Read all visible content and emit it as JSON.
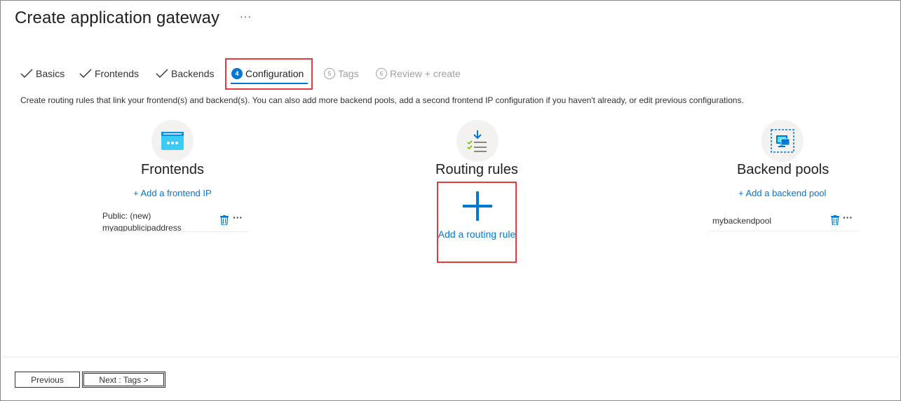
{
  "header": {
    "title": "Create application gateway",
    "more_label": "···"
  },
  "tabs": [
    {
      "label": "Basics",
      "state": "done"
    },
    {
      "label": "Frontends",
      "state": "done"
    },
    {
      "label": "Backends",
      "state": "done"
    },
    {
      "label": "Configuration",
      "number": "4",
      "state": "active"
    },
    {
      "label": "Tags",
      "number": "5",
      "state": "disabled"
    },
    {
      "label": "Review + create",
      "number": "6",
      "state": "disabled"
    }
  ],
  "description": "Create routing rules that link your frontend(s) and backend(s). You can also add more backend pools, add a second frontend IP configuration if you haven't already, or edit previous configurations.",
  "frontends": {
    "title": "Frontends",
    "add_link": "+ Add a frontend IP",
    "items": [
      {
        "line1": "Public: (new)",
        "line2": "myagpublicipaddress"
      }
    ]
  },
  "routing": {
    "title": "Routing rules",
    "add_label": "Add a routing rule"
  },
  "backends": {
    "title": "Backend pools",
    "add_link": "+ Add a backend pool",
    "items": [
      {
        "name": "mybackendpool"
      }
    ]
  },
  "footer": {
    "previous_label": "Previous",
    "next_label": "Next : Tags >"
  },
  "colors": {
    "accent": "#0078d4",
    "highlight": "#e3393f",
    "text": "#323130",
    "disabled": "#a19f9d"
  }
}
